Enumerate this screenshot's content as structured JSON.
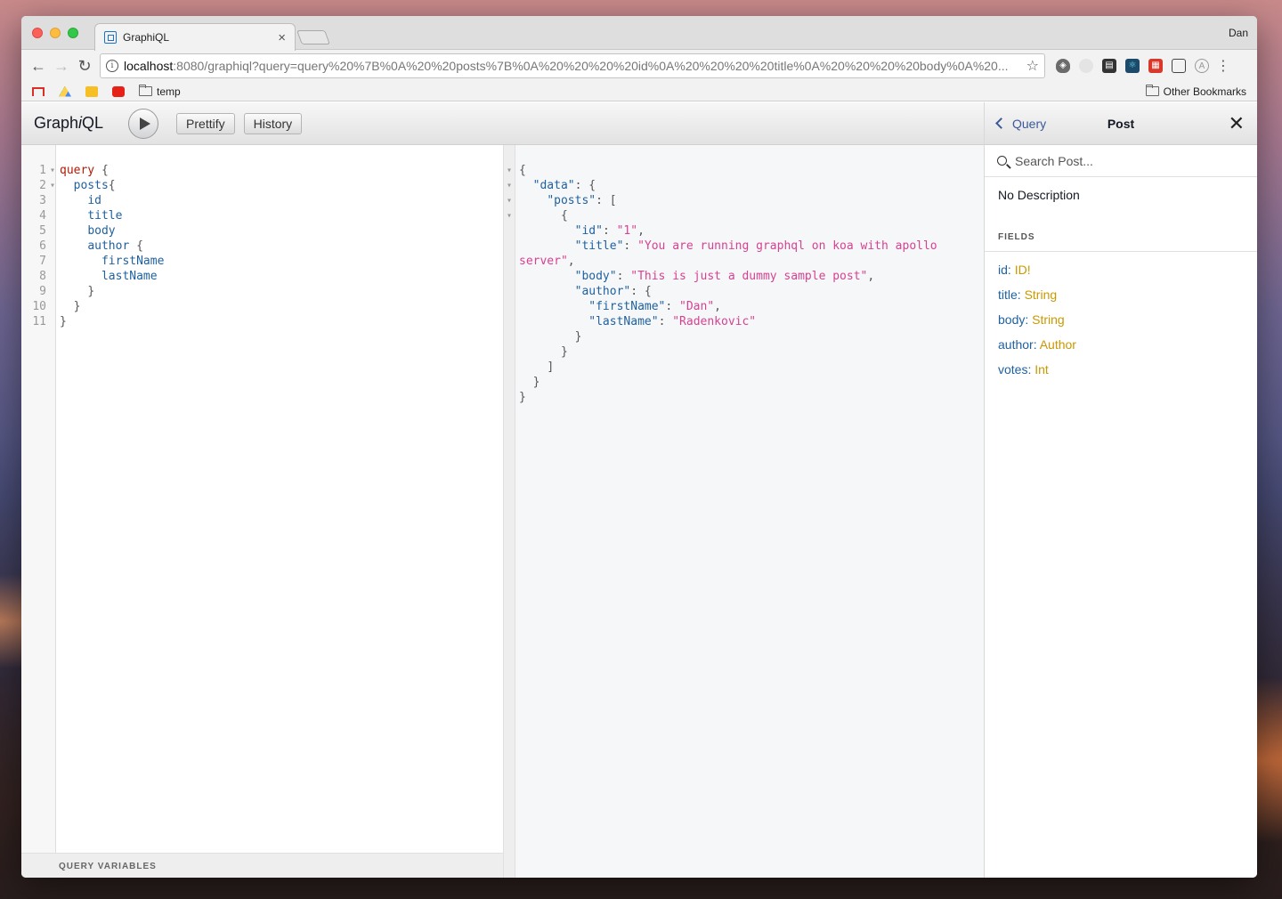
{
  "browser": {
    "tab_title": "GraphiQL",
    "profile_name": "Dan",
    "url_host": "localhost",
    "url_rest": ":8080/graphiql?query=query%20%7B%0A%20%20posts%7B%0A%20%20%20%20id%0A%20%20%20%20title%0A%20%20%20%20body%0A%20...",
    "bookmarks": {
      "folder": "temp",
      "other": "Other Bookmarks"
    }
  },
  "graphiql": {
    "logo_main": "Graph",
    "logo_i": "i",
    "logo_end": "QL",
    "prettify_label": "Prettify",
    "history_label": "History",
    "query_variables_label": "QUERY VARIABLES",
    "line_numbers": [
      "1",
      "2",
      "3",
      "4",
      "5",
      "6",
      "7",
      "8",
      "9",
      "10",
      "11"
    ],
    "query_lines": [
      {
        "indent": "",
        "tokens": [
          {
            "t": "query",
            "c": "kw"
          },
          {
            "t": " {",
            "c": "pn"
          }
        ]
      },
      {
        "indent": "  ",
        "tokens": [
          {
            "t": "posts",
            "c": "fld"
          },
          {
            "t": "{",
            "c": "pn"
          }
        ]
      },
      {
        "indent": "    ",
        "tokens": [
          {
            "t": "id",
            "c": "fld"
          }
        ]
      },
      {
        "indent": "    ",
        "tokens": [
          {
            "t": "title",
            "c": "fld"
          }
        ]
      },
      {
        "indent": "    ",
        "tokens": [
          {
            "t": "body",
            "c": "fld"
          }
        ]
      },
      {
        "indent": "    ",
        "tokens": [
          {
            "t": "author",
            "c": "fld"
          },
          {
            "t": " {",
            "c": "pn"
          }
        ]
      },
      {
        "indent": "      ",
        "tokens": [
          {
            "t": "firstName",
            "c": "fld"
          }
        ]
      },
      {
        "indent": "      ",
        "tokens": [
          {
            "t": "lastName",
            "c": "fld"
          }
        ]
      },
      {
        "indent": "    ",
        "tokens": [
          {
            "t": "}",
            "c": "pn"
          }
        ]
      },
      {
        "indent": "  ",
        "tokens": [
          {
            "t": "}",
            "c": "pn"
          }
        ]
      },
      {
        "indent": "",
        "tokens": [
          {
            "t": "}",
            "c": "pn"
          }
        ]
      }
    ],
    "result_lines": [
      {
        "fold": true,
        "indent": "",
        "tokens": [
          {
            "t": "{",
            "c": "pn"
          }
        ]
      },
      {
        "fold": true,
        "indent": "  ",
        "tokens": [
          {
            "t": "\"data\"",
            "c": "key"
          },
          {
            "t": ": {",
            "c": "pn"
          }
        ]
      },
      {
        "fold": true,
        "indent": "    ",
        "tokens": [
          {
            "t": "\"posts\"",
            "c": "key"
          },
          {
            "t": ": [",
            "c": "pn"
          }
        ]
      },
      {
        "fold": true,
        "indent": "      ",
        "tokens": [
          {
            "t": "{",
            "c": "pn"
          }
        ]
      },
      {
        "fold": false,
        "indent": "        ",
        "tokens": [
          {
            "t": "\"id\"",
            "c": "key"
          },
          {
            "t": ": ",
            "c": "pn"
          },
          {
            "t": "\"1\"",
            "c": "str"
          },
          {
            "t": ",",
            "c": "pn"
          }
        ]
      },
      {
        "fold": false,
        "indent": "        ",
        "tokens": [
          {
            "t": "\"title\"",
            "c": "key"
          },
          {
            "t": ": ",
            "c": "pn"
          },
          {
            "t": "\"You are running graphql on koa with apollo",
            "c": "str"
          }
        ]
      },
      {
        "fold": false,
        "indent": "",
        "tokens": [
          {
            "t": "server\"",
            "c": "str"
          },
          {
            "t": ",",
            "c": "pn"
          }
        ]
      },
      {
        "fold": false,
        "indent": "        ",
        "tokens": [
          {
            "t": "\"body\"",
            "c": "key"
          },
          {
            "t": ": ",
            "c": "pn"
          },
          {
            "t": "\"This is just a dummy sample post\"",
            "c": "str"
          },
          {
            "t": ",",
            "c": "pn"
          }
        ]
      },
      {
        "fold": false,
        "indent": "        ",
        "tokens": [
          {
            "t": "\"author\"",
            "c": "key"
          },
          {
            "t": ": {",
            "c": "pn"
          }
        ]
      },
      {
        "fold": false,
        "indent": "          ",
        "tokens": [
          {
            "t": "\"firstName\"",
            "c": "key"
          },
          {
            "t": ": ",
            "c": "pn"
          },
          {
            "t": "\"Dan\"",
            "c": "str"
          },
          {
            "t": ",",
            "c": "pn"
          }
        ]
      },
      {
        "fold": false,
        "indent": "          ",
        "tokens": [
          {
            "t": "\"lastName\"",
            "c": "key"
          },
          {
            "t": ": ",
            "c": "pn"
          },
          {
            "t": "\"Radenkovic\"",
            "c": "str"
          }
        ]
      },
      {
        "fold": false,
        "indent": "        ",
        "tokens": [
          {
            "t": "}",
            "c": "pn"
          }
        ]
      },
      {
        "fold": false,
        "indent": "      ",
        "tokens": [
          {
            "t": "}",
            "c": "pn"
          }
        ]
      },
      {
        "fold": false,
        "indent": "    ",
        "tokens": [
          {
            "t": "]",
            "c": "pn"
          }
        ]
      },
      {
        "fold": false,
        "indent": "  ",
        "tokens": [
          {
            "t": "}",
            "c": "pn"
          }
        ]
      },
      {
        "fold": false,
        "indent": "",
        "tokens": [
          {
            "t": "}",
            "c": "pn"
          }
        ]
      }
    ]
  },
  "docs": {
    "back_label": "Query",
    "title": "Post",
    "search_placeholder": "Search Post...",
    "description": "No Description",
    "fields_heading": "FIELDS",
    "fields": [
      {
        "name": "id",
        "type": "ID!"
      },
      {
        "name": "title",
        "type": "String"
      },
      {
        "name": "body",
        "type": "String"
      },
      {
        "name": "author",
        "type": "Author"
      },
      {
        "name": "votes",
        "type": "Int"
      }
    ]
  },
  "colors": {
    "keyword": "#b11a04",
    "field": "#1f61a0",
    "string": "#d64292",
    "type": "#ca9800"
  },
  "icons": {
    "back": "chevron-left-icon",
    "close": "close-icon",
    "search": "search-icon",
    "run": "play-icon"
  }
}
